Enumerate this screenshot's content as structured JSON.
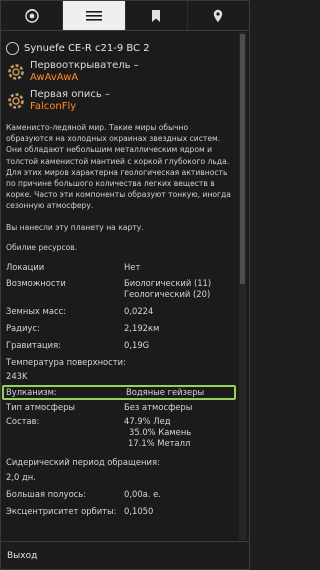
{
  "system": {
    "name": "Synuefe CE-R c21-9 BC 2"
  },
  "discoverer": {
    "label": "Первооткрыватель –",
    "name": "AwAvAwA"
  },
  "first_description": {
    "label": "Первая опись –",
    "name": "FalconFly"
  },
  "description": "Каменисто-ледяной мир. Такие миры обычно образуются на холодных окраинах звездных систем. Они обладают небольшим металлическим ядром и толстой каменистой мантией с коркой глубокого льда. Для этих миров характерна геологическая активность по причине большого количества легких веществ в корке. Часто эти компоненты образуют тонкую, иногда сезонную атмосферу.",
  "mapped_text": "Вы нанесли эту планету на карту.",
  "resources_text": "Обилие ресурсов.",
  "props": {
    "locations": {
      "k": "Локации",
      "v": "Нет"
    },
    "possibilities": {
      "k": "Возможности",
      "v1": "Биологический (11)",
      "v2": "Геологический (20)"
    },
    "earth_masses": {
      "k": "Земных масс:",
      "v": "0,0224"
    },
    "radius": {
      "k": "Радиус:",
      "v": "2,192км"
    },
    "gravity": {
      "k": "Гравитация:",
      "v": "0,19G"
    },
    "surface_temp": {
      "k": "Температура поверхности:",
      "v": "243K"
    },
    "volcanism": {
      "k": "Вулканизм:",
      "v": "Водяные гейзеры"
    },
    "atmosphere_type": {
      "k": "Тип атмосферы",
      "v": "Без атмосферы"
    },
    "composition": {
      "k": "Состав:",
      "v1": "47.9% Лед",
      "v2": "35.0% Камень",
      "v3": "17.1% Металл"
    },
    "sidereal_period": {
      "k": "Сидерический период обращения:",
      "v": "2,0 дн."
    },
    "semi_major_axis": {
      "k": "Большая полуось:",
      "v": "0,00а. е."
    },
    "eccentricity": {
      "k": "Эксцентриситет орбиты:",
      "v": "0,1050"
    }
  },
  "bottom": {
    "exit_label": "Выход"
  },
  "tabs": [
    "system-icon",
    "list-icon",
    "bookmark-icon",
    "location-pin-icon"
  ],
  "colors": {
    "accent_orange": "#ff8a2a",
    "highlight_green": "#93d35a",
    "active_tab": "#efefef"
  }
}
